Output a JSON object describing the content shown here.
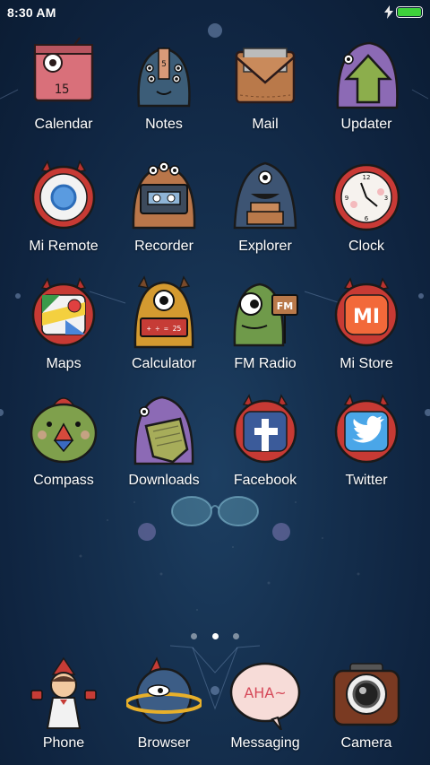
{
  "status_bar": {
    "time": "8:30 AM",
    "battery_level": 1.0,
    "charging": true,
    "battery_color": "#3ed23b"
  },
  "apps": [
    {
      "label": "Calendar",
      "icon": "calendar-monster-icon"
    },
    {
      "label": "Notes",
      "icon": "notes-monster-icon"
    },
    {
      "label": "Mail",
      "icon": "mail-envelope-icon"
    },
    {
      "label": "Updater",
      "icon": "updater-arrow-icon"
    },
    {
      "label": "Mi Remote",
      "icon": "mi-remote-monster-icon"
    },
    {
      "label": "Recorder",
      "icon": "recorder-cassette-icon"
    },
    {
      "label": "Explorer",
      "icon": "explorer-monster-icon"
    },
    {
      "label": "Clock",
      "icon": "clock-icon"
    },
    {
      "label": "Maps",
      "icon": "maps-icon"
    },
    {
      "label": "Calculator",
      "icon": "calculator-monster-icon"
    },
    {
      "label": "FM Radio",
      "icon": "fm-radio-monster-icon"
    },
    {
      "label": "Mi Store",
      "icon": "mi-store-icon"
    },
    {
      "label": "Compass",
      "icon": "compass-monster-icon"
    },
    {
      "label": "Downloads",
      "icon": "downloads-icon"
    },
    {
      "label": "Facebook",
      "icon": "facebook-icon"
    },
    {
      "label": "Twitter",
      "icon": "twitter-icon"
    }
  ],
  "pager": {
    "pages": 3,
    "current": 2
  },
  "dock": [
    {
      "label": "Phone",
      "icon": "phone-kid-icon"
    },
    {
      "label": "Browser",
      "icon": "browser-planet-icon"
    },
    {
      "label": "Messaging",
      "icon": "messaging-bubble-icon"
    },
    {
      "label": "Camera",
      "icon": "camera-icon"
    }
  ],
  "messaging_bubble_text": "AHA~",
  "calendar_digits": "15",
  "notes_tag_text": "5",
  "calculator_display": "+ ÷ = 25",
  "fm_sign_text": "FM",
  "mi_store_logo": "MI"
}
